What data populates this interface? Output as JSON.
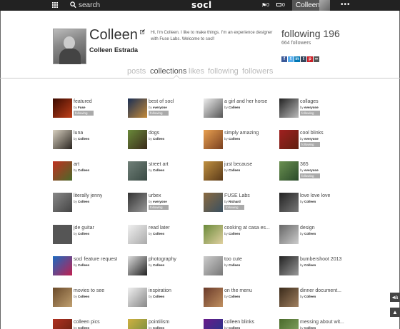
{
  "topbar": {
    "search_label": "search",
    "logo": "socl",
    "flag_count": "0",
    "mail_count": "0",
    "username": "Colleen",
    "more": "•••"
  },
  "profile": {
    "name": "Colleen",
    "full_name": "Colleen Estrada",
    "bio": "Hi, I'm Colleen. I like to make things. I'm an experience designer with Fuse Labs. Welcome to socl!",
    "following": "following 196",
    "followers": "664 followers",
    "social_icons": [
      {
        "name": "facebook-icon",
        "glyph": "f",
        "color": "#3b5998"
      },
      {
        "name": "twitter-icon",
        "glyph": "t",
        "color": "#55acee"
      },
      {
        "name": "linkedin-icon",
        "glyph": "in",
        "color": "#0077b5"
      },
      {
        "name": "tumblr-icon",
        "glyph": "t",
        "color": "#35465c"
      },
      {
        "name": "pinterest-icon",
        "glyph": "p",
        "color": "#cb2027"
      },
      {
        "name": "link-icon",
        "glyph": "∞",
        "color": "#555555"
      }
    ]
  },
  "tabs": [
    "posts",
    "collections",
    "likes",
    "following",
    "followers"
  ],
  "active_tab": "collections",
  "collections": [
    {
      "title": "featured",
      "by_prefix": "by",
      "by": "Fuse",
      "following": "following",
      "colors": [
        "#3a0a00",
        "#c0401a"
      ]
    },
    {
      "title": "best of socl",
      "by_prefix": "by",
      "by": "everyone",
      "following": "following",
      "colors": [
        "#1a2f55",
        "#c48a3a"
      ]
    },
    {
      "title": "a girl and her horse",
      "by_prefix": "by",
      "by": "Colleen",
      "following": "",
      "colors": [
        "#eee",
        "#555"
      ]
    },
    {
      "title": "collages",
      "by_prefix": "by",
      "by": "everyone",
      "following": "following",
      "colors": [
        "#222",
        "#bbb"
      ]
    },
    {
      "title": "luna",
      "by_prefix": "by",
      "by": "Colleen",
      "following": "",
      "colors": [
        "#d8d0c0",
        "#2a2520"
      ]
    },
    {
      "title": "dogs",
      "by_prefix": "by",
      "by": "Colleen",
      "following": "",
      "colors": [
        "#6a8a3a",
        "#3a2a1a"
      ]
    },
    {
      "title": "simply amazing",
      "by_prefix": "by",
      "by": "Colleen",
      "following": "",
      "colors": [
        "#e8a050",
        "#7a4020"
      ]
    },
    {
      "title": "cool blinks",
      "by_prefix": "by",
      "by": "everyone",
      "following": "following",
      "colors": [
        "#a02020",
        "#602010"
      ]
    },
    {
      "title": "art",
      "by_prefix": "by",
      "by": "Colleen",
      "following": "",
      "colors": [
        "#c03020",
        "#4a6a2a"
      ]
    },
    {
      "title": "street art",
      "by_prefix": "by",
      "by": "Colleen",
      "following": "",
      "colors": [
        "#708078",
        "#3a4a44"
      ]
    },
    {
      "title": "just because",
      "by_prefix": "by",
      "by": "Colleen",
      "following": "",
      "colors": [
        "#c09040",
        "#5a3a1a"
      ]
    },
    {
      "title": "365",
      "by_prefix": "by",
      "by": "everyone",
      "following": "following",
      "colors": [
        "#6a9050",
        "#2a4a2a"
      ]
    },
    {
      "title": "literally jenny",
      "by_prefix": "by",
      "by": "Colleen",
      "following": "",
      "colors": [
        "#888",
        "#444"
      ]
    },
    {
      "title": "urbex",
      "by_prefix": "by",
      "by": "everyone",
      "following": "following",
      "colors": [
        "#333",
        "#999"
      ]
    },
    {
      "title": "FUSE Labs",
      "by_prefix": "by",
      "by": "Richard",
      "following": "following",
      "colors": [
        "#8a6a40",
        "#3a5060"
      ]
    },
    {
      "title": "love love love",
      "by_prefix": "by",
      "by": "Colleen",
      "following": "",
      "colors": [
        "#222",
        "#777"
      ]
    },
    {
      "title": "jde guitar",
      "by_prefix": "by",
      "by": "Colleen",
      "following": "",
      "colors": [
        "#555",
        "#555"
      ]
    },
    {
      "title": "read later",
      "by_prefix": "by",
      "by": "Colleen",
      "following": "",
      "colors": [
        "#f0f0f0",
        "#aaa"
      ]
    },
    {
      "title": "cooking at casa es...",
      "by_prefix": "by",
      "by": "Colleen",
      "following": "",
      "colors": [
        "#6a8a3a",
        "#e0d0a0"
      ]
    },
    {
      "title": "design",
      "by_prefix": "by",
      "by": "Colleen",
      "following": "",
      "colors": [
        "#666",
        "#ccc"
      ]
    },
    {
      "title": "socl feature request",
      "by_prefix": "by",
      "by": "Colleen",
      "following": "",
      "colors": [
        "#1a6ac0",
        "#c02050"
      ]
    },
    {
      "title": "photography",
      "by_prefix": "by",
      "by": "Colleen",
      "following": "",
      "colors": [
        "#ddd",
        "#222"
      ]
    },
    {
      "title": "too cute",
      "by_prefix": "by",
      "by": "Colleen",
      "following": "",
      "colors": [
        "#ccc",
        "#777"
      ]
    },
    {
      "title": "bumbershoot 2013",
      "by_prefix": "by",
      "by": "Colleen",
      "following": "",
      "colors": [
        "#222",
        "#999"
      ]
    },
    {
      "title": "movies to see",
      "by_prefix": "by",
      "by": "Colleen",
      "following": "",
      "colors": [
        "#6a4a2a",
        "#c0a070"
      ]
    },
    {
      "title": "inspiration",
      "by_prefix": "by",
      "by": "Colleen",
      "following": "",
      "colors": [
        "#f0f0f0",
        "#888"
      ]
    },
    {
      "title": "on the menu",
      "by_prefix": "by",
      "by": "Colleen",
      "following": "",
      "colors": [
        "#6a3a2a",
        "#c09060"
      ]
    },
    {
      "title": "dinner document...",
      "by_prefix": "by",
      "by": "Colleen",
      "following": "",
      "colors": [
        "#3a2a1a",
        "#a08060"
      ]
    },
    {
      "title": "colleen pics",
      "by_prefix": "by",
      "by": "Colleen",
      "following": "",
      "colors": [
        "#b03020",
        "#602010"
      ]
    },
    {
      "title": "pointilism",
      "by_prefix": "by",
      "by": "Colleen",
      "following": "",
      "colors": [
        "#d0b040",
        "#6a8a40"
      ]
    },
    {
      "title": "colleen blinks",
      "by_prefix": "by",
      "by": "Colleen",
      "following": "",
      "colors": [
        "#6a1a8a",
        "#1a3a8a"
      ]
    },
    {
      "title": "messing about wit...",
      "by_prefix": "by",
      "by": "Colleen",
      "following": "",
      "colors": [
        "#4a6a2a",
        "#8aaa6a"
      ]
    }
  ],
  "side_widgets": [
    "◂a",
    "▲"
  ]
}
